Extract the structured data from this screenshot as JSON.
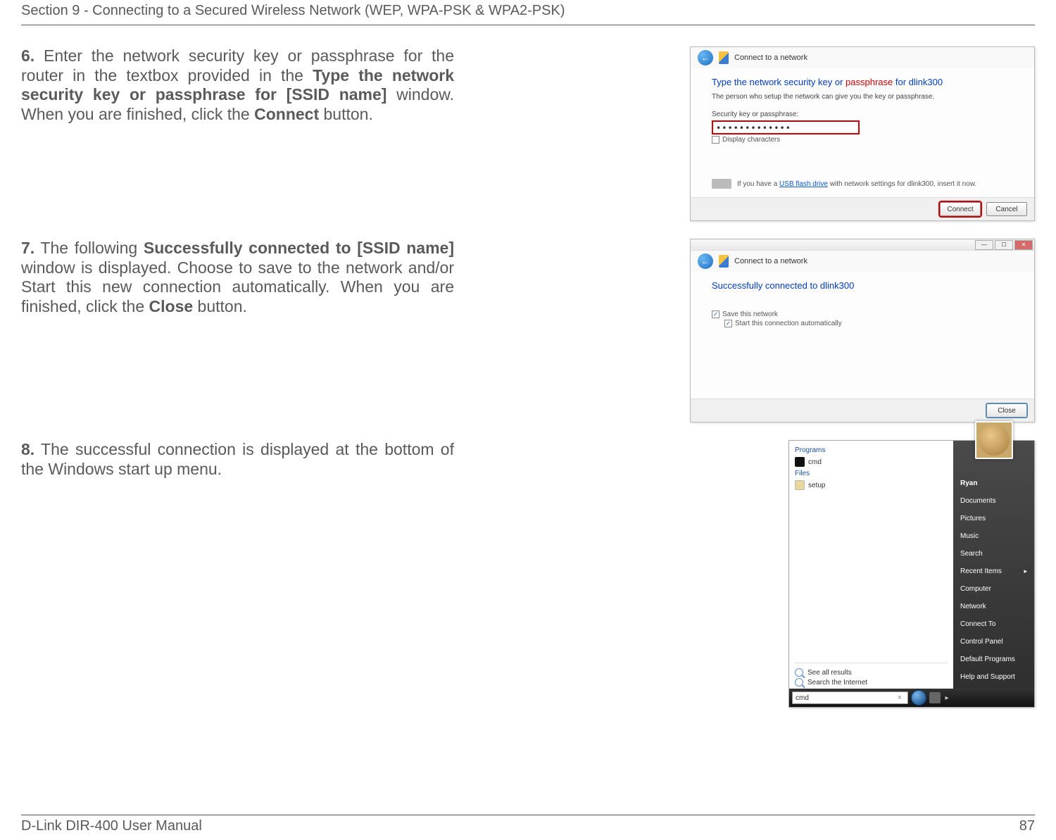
{
  "header": "Section 9 - Connecting to a Secured Wireless Network (WEP, WPA-PSK & WPA2-PSK)",
  "steps": {
    "s6": {
      "num": "6.",
      "p1": " Enter the network security key or passphrase for the router in the textbox provided in the ",
      "b1": "Type the network security key or passphrase for [SSID name]",
      "p2": " window. When you are finished, click the ",
      "b2": "Connect",
      "p3": " button."
    },
    "s7": {
      "num": "7.",
      "p1": " The following ",
      "b1": "Successfully connected to [SSID name]",
      "p2": " window is displayed. Choose to save to the network and/or Start this new connection automatically. When you are finished, click the ",
      "b2": "Close",
      "p3": " button."
    },
    "s8": {
      "num": "8.",
      "p1": " The successful connection is displayed at the bottom of the Windows start up menu."
    }
  },
  "win6": {
    "navLabel": "Connect to a network",
    "titleA": "Type the network security key or ",
    "titleB": "passphrase ",
    "titleC": "for dlink300",
    "sub": "The person who setup the network can give you the key or passphrase.",
    "fieldLabel": "Security key or passphrase:",
    "fieldValue": "•••••••••••••",
    "displayChars": "Display characters",
    "usbA": "If you have a ",
    "usbLink": "USB flash drive",
    "usbB": " with network settings for dlink300, insert it now.",
    "connect": "Connect",
    "cancel": "Cancel"
  },
  "win7": {
    "navLabel": "Connect to a network",
    "title": "Successfully connected to dlink300",
    "save": "Save this network",
    "auto": "Start this connection automatically",
    "close": "Close"
  },
  "startmenu": {
    "programs": "Programs",
    "cmd": "cmd",
    "files": "Files",
    "setup": "setup",
    "seeAll": "See all results",
    "searchNet": "Search the Internet",
    "taskText": "cmd",
    "right": {
      "ryan": "Ryan",
      "documents": "Documents",
      "pictures": "Pictures",
      "music": "Music",
      "search": "Search",
      "recent": "Recent Items",
      "computer": "Computer",
      "network": "Network",
      "connect": "Connect To",
      "cpanel": "Control Panel",
      "defprog": "Default Programs",
      "help": "Help and Support"
    }
  },
  "footer": {
    "left": "D-Link DIR-400 User Manual",
    "right": "87"
  }
}
